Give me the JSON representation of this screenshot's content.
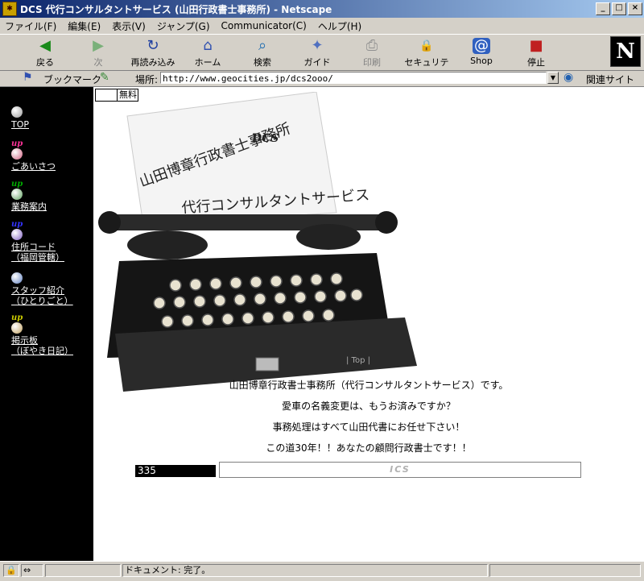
{
  "window": {
    "title": "DCS 代行コンサルタントサービス (山田行政書士事務所) - Netscape",
    "controls": {
      "minimize": "_",
      "maximize": "□",
      "close": "×"
    }
  },
  "menu": [
    "ファイル(F)",
    "編集(E)",
    "表示(V)",
    "ジャンプ(G)",
    "Communicator(C)",
    "ヘルプ(H)"
  ],
  "toolbar": {
    "buttons": [
      {
        "label": "戻る",
        "icon": "back-arrow-icon",
        "glyph": "◀"
      },
      {
        "label": "次",
        "icon": "forward-arrow-icon",
        "glyph": "▶"
      },
      {
        "label": "再読み込み",
        "icon": "reload-icon",
        "glyph": "↻"
      },
      {
        "label": "ホーム",
        "icon": "home-icon",
        "glyph": "⌂"
      },
      {
        "label": "検索",
        "icon": "search-icon",
        "glyph": "⌕"
      },
      {
        "label": "ガイド",
        "icon": "guide-icon",
        "glyph": "✦"
      },
      {
        "label": "印刷",
        "icon": "print-icon",
        "glyph": "⎙"
      },
      {
        "label": "セキュリティ",
        "icon": "lock-icon",
        "glyph": "🔒"
      },
      {
        "label": "Shop",
        "icon": "shop-icon",
        "glyph": "@"
      },
      {
        "label": "停止",
        "icon": "stop-icon",
        "glyph": "■"
      }
    ],
    "logo": "N"
  },
  "location_bar": {
    "bookmarks_label": "ブックマーク",
    "location_label": "場所:",
    "url": "http://www.geocities.jp/dcs2ooo/",
    "related_label": "関連サイト"
  },
  "page": {
    "free_label": "無料",
    "typewriter_sign": {
      "line1": "山田博章行政書士事務所",
      "line2": "DCS",
      "line3": "代行コンサルタントサービス"
    },
    "nav": [
      {
        "label": "TOP",
        "badge": ""
      },
      {
        "label": "ごあいさつ",
        "badge": "up"
      },
      {
        "label": "業務案内",
        "badge": "up"
      },
      {
        "label": "住所コード",
        "label2": "（福岡管轄）",
        "badge": "up"
      },
      {
        "label": "スタッフ紹介",
        "label2": "（ひとりごと）",
        "badge": ""
      },
      {
        "label": "掲示板",
        "label2": "（ぼやき日記）",
        "badge": "up"
      }
    ],
    "top_link": "| Top |",
    "lines": [
      "山田博章行政書士事務所（代行コンサルタントサービス）です。",
      "愛車の名義変更は、もうお済みですか？",
      "事務処理はすべて山田代書にお任せ下さい！",
      "この道30年！！あなたの顧問行政書士です！！"
    ],
    "counter": "335",
    "banner_text": "ICS"
  },
  "status": {
    "text": "ドキュメント: 完了。"
  },
  "colors": {
    "title_start": "#0a246a",
    "title_end": "#a6caf0",
    "sidebar": "#000000",
    "badge_pink": "#ff3399",
    "badge_green": "#00aa00",
    "badge_blue": "#3333ff",
    "badge_yellow": "#cccc00"
  }
}
